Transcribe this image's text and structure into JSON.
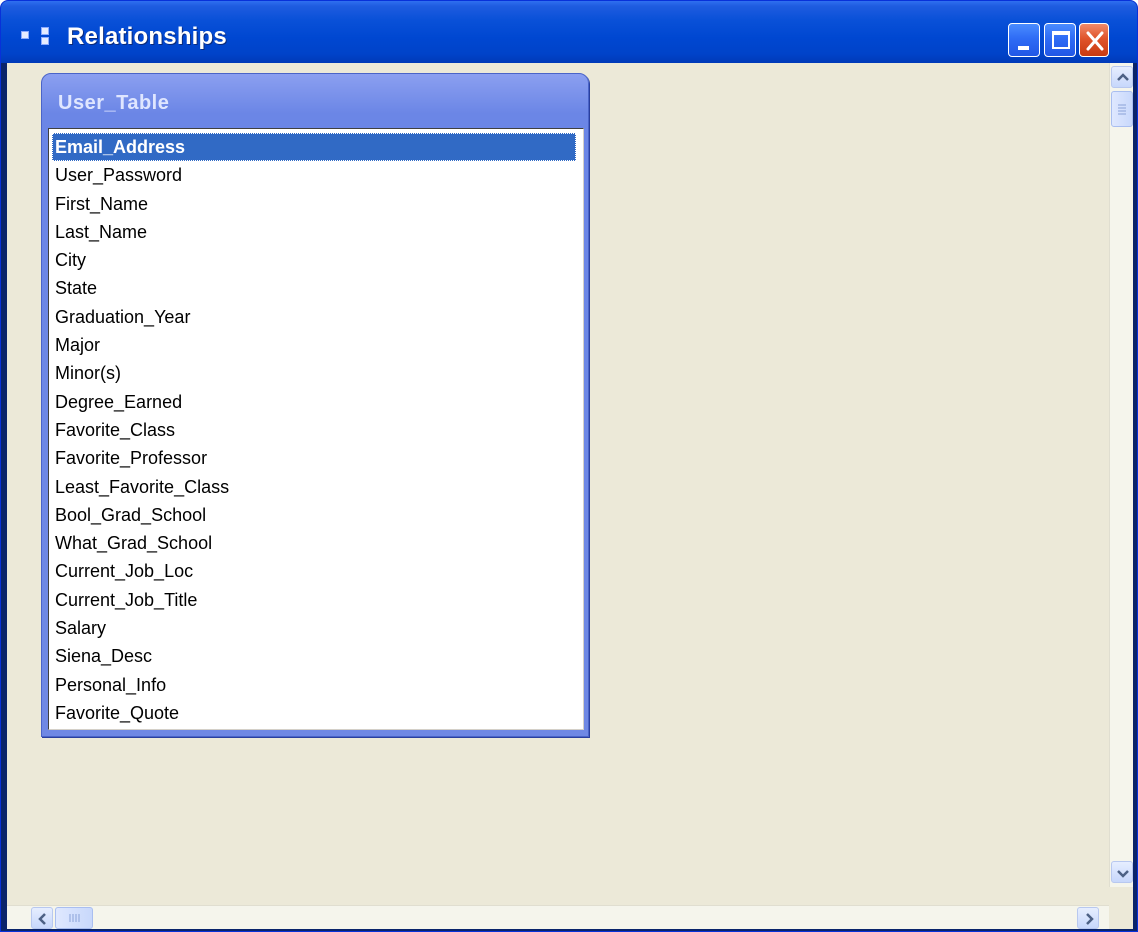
{
  "window": {
    "title": "Relationships",
    "controls": {
      "minimize": "minimize-icon",
      "maximize": "maximize-icon",
      "close": "close-icon"
    }
  },
  "colors": {
    "titlebar": "#0054e3",
    "client_bg": "#ece9d8",
    "table_header": "#7088e6",
    "selection": "#316ac5"
  },
  "table": {
    "name": "User_Table",
    "selected_index": 0,
    "fields": [
      "Email_Address",
      "User_Password",
      "First_Name",
      "Last_Name",
      "City",
      "State",
      "Graduation_Year",
      "Major",
      "Minor(s)",
      "Degree_Earned",
      "Favorite_Class",
      "Favorite_Professor",
      "Least_Favorite_Class",
      "Bool_Grad_School",
      "What_Grad_School",
      "Current_Job_Loc",
      "Current_Job_Title",
      "Salary",
      "Siena_Desc",
      "Personal_Info",
      "Favorite_Quote"
    ]
  }
}
